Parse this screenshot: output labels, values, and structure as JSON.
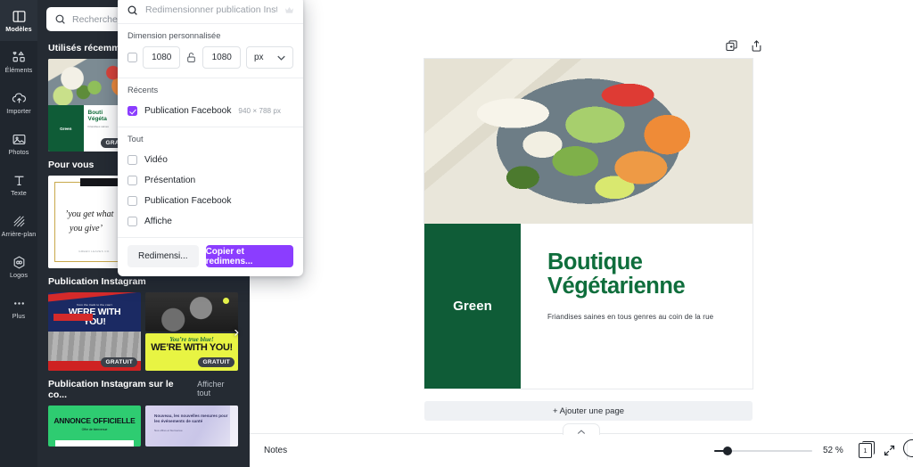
{
  "rail": {
    "items": [
      {
        "label": "Modèles",
        "icon": "templates-icon",
        "active": true
      },
      {
        "label": "Éléments",
        "icon": "elements-icon",
        "active": false
      },
      {
        "label": "Importer",
        "icon": "upload-icon",
        "active": false
      },
      {
        "label": "Photos",
        "icon": "photos-icon",
        "active": false
      },
      {
        "label": "Texte",
        "icon": "text-icon",
        "active": false
      },
      {
        "label": "Arrière-plan",
        "icon": "background-icon",
        "active": false
      },
      {
        "label": "Logos",
        "icon": "logos-icon",
        "active": false
      },
      {
        "label": "Plus",
        "icon": "more-icon",
        "active": false
      }
    ]
  },
  "panel": {
    "search_placeholder": "Recherche",
    "sections": [
      {
        "title": "Utilisés récemment",
        "more": ""
      },
      {
        "title": "Pour vous",
        "more": ""
      },
      {
        "title": "Publication Instagram",
        "more": ""
      },
      {
        "title": "Publication Instagram sur le co...",
        "more": "Afficher tout"
      }
    ],
    "recent_card": {
      "brand": "Green",
      "title_line1": "Bouti",
      "title_line2": "Végéta",
      "subtitle": "Friandises saines",
      "badge": "GRATUIT"
    },
    "quote_card": {
      "line1": "’you get what",
      "line2": "you give’",
      "signature": "GREEN LEAVES CO."
    },
    "sport_card_1": {
      "kicker": "from the track to the court",
      "title_line1": "WERE WITH",
      "title_line2": "YOU!",
      "badge": "GRATUIT"
    },
    "sport_card_2": {
      "script": "You’re true blue!",
      "title": "WE’RE WITH YOU!",
      "badge": "GRATUIT"
    },
    "announce_card": {
      "title": "ANNONCE OFFICIELLE",
      "subtitle": "Offre de bienvenue"
    },
    "lavender_card": {
      "line1": "Nouveau, les nouvelles mesures pour les événements de santé",
      "line2": "Nos offres et bienvenue"
    },
    "next_arrow": "›"
  },
  "resize_dropdown": {
    "search_placeholder": "Redimensionner publication Instag",
    "crown_icon": "crown-icon",
    "custom_label": "Dimension personnalisée",
    "width_value": "1080",
    "height_value": "1080",
    "unit_value": "px",
    "lock_icon": "unlock-icon",
    "recent_label": "Récents",
    "recent_items": [
      {
        "name": "Publication Facebook",
        "size": "940 × 788 px",
        "checked": true
      }
    ],
    "all_label": "Tout",
    "all_items": [
      {
        "name": "Vidéo",
        "checked": false
      },
      {
        "name": "Présentation",
        "checked": false
      },
      {
        "name": "Publication Facebook",
        "checked": false
      },
      {
        "name": "Affiche",
        "checked": false
      }
    ],
    "secondary_button": "Redimensi...",
    "primary_button": "Copier et redimens...",
    "accent_color": "#8b3dff"
  },
  "canvas": {
    "tools": [
      {
        "name": "duplicate-page-icon"
      },
      {
        "name": "add-page-icon"
      }
    ],
    "design": {
      "brand": "Green",
      "title_line1": "Boutique",
      "title_line2": "Végétarienne",
      "tagline": "Friandises saines en tous genres au coin de la rue",
      "brand_color": "#0f5c37",
      "title_color": "#0f6e3c"
    },
    "add_page_label": "+ Ajouter une page"
  },
  "bottom_bar": {
    "notes_label": "Notes",
    "zoom_value": "52 %",
    "zoom_percent": 52,
    "page_number": "1",
    "fullscreen_icon": "expand-icon",
    "help_icon": "help-icon",
    "collapse_icon": "chevron-up-icon"
  }
}
